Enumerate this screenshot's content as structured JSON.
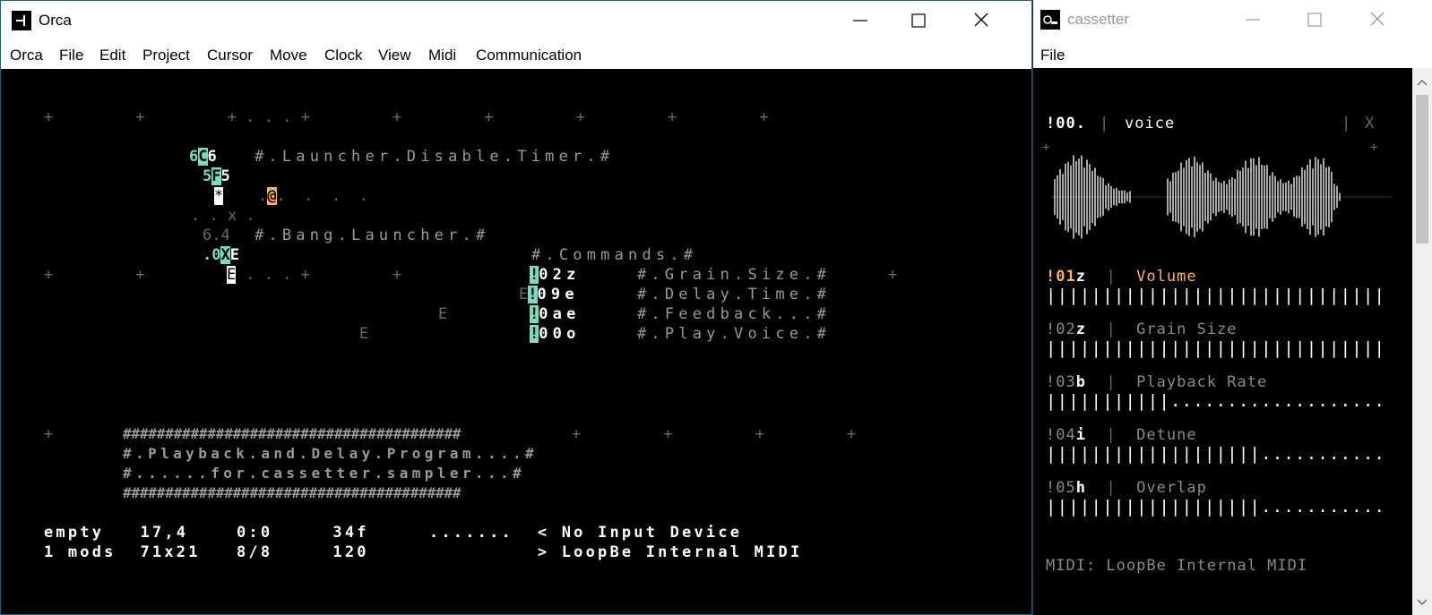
{
  "orca": {
    "title": "Orca",
    "menu": [
      "Orca",
      "File",
      "Edit",
      "Project",
      "Cursor",
      "Move",
      "Clock",
      "View",
      "Midi",
      "Communication"
    ],
    "grid": {
      "row1": "+         +         + . . . +         +         +         +         +         +",
      "launcher_comment": "#.Launcher.Disable.Timer.#",
      "bang_comment": "#.Bang.Launcher.#",
      "commands_comment": "#.Commands.#",
      "row7": "+         +         + . . . +         +",
      "row7_end": "+",
      "cmd1": "02z",
      "cmd2": "09e",
      "cmd3": "0ae",
      "cmd4": "00o",
      "cmd1_comment": "#.Grain.Size.#",
      "cmd2_comment": "#.Delay.Time.#",
      "cmd3_comment": "#.Feedback...#",
      "cmd4_comment": "#.Play.Voice.#",
      "row12_left": "+",
      "row12_right": "+         +         +         +",
      "prog1": "########################################",
      "prog2": "#.Playback.and.Delay.Program....#",
      "prog3": "#......for.cassetter.sampler...#",
      "prog4": "########################################"
    },
    "status": {
      "line1": "empty   17,4    0:0     34f     .......  < No Input Device",
      "line2": "1 mods  71x21   8/8     120              > LoopBe Internal MIDI"
    }
  },
  "cassetter": {
    "title": "cassetter",
    "menu": [
      "File"
    ],
    "voice": {
      "id": "!00.",
      "name": "voice",
      "close": "X"
    },
    "params": [
      {
        "id": "!01",
        "code": "z",
        "name": "Volume",
        "fill": 1.0
      },
      {
        "id": "!02",
        "code": "z",
        "name": "Grain Size",
        "fill": 1.0
      },
      {
        "id": "!03",
        "code": "b",
        "name": "Playback Rate",
        "fill": 0.3
      },
      {
        "id": "!04",
        "code": "i",
        "name": "Detune",
        "fill": 0.5
      },
      {
        "id": "!05",
        "code": "h",
        "name": "Overlap",
        "fill": 0.5
      }
    ],
    "midi": "MIDI: LoopBe Internal MIDI"
  }
}
